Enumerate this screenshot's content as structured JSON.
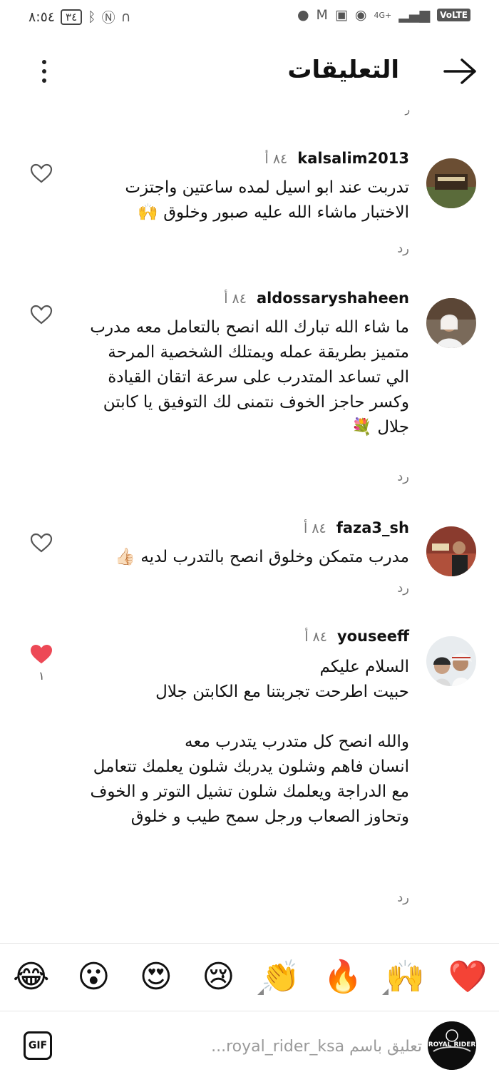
{
  "status_bar": {
    "time": "٨:٥٤",
    "battery": "٣٤",
    "network": "4G+",
    "volte": "VoLTE"
  },
  "header": {
    "title": "التعليقات"
  },
  "comments": [
    {
      "username": "kalsalim2013",
      "time": "٨٤ أ",
      "text": "تدربت عند ابو اسيل لمده ساعتين واجتزت الاختبار  ماشاء الله عليه صبور وخلوق 🙌",
      "reply_label": "رد",
      "liked": false,
      "like_count": ""
    },
    {
      "username": "aldossaryshaheen",
      "time": "٨٤ أ",
      "text": "ما شاء الله تبارك الله انصح بالتعامل معه مدرب متميز بطريقة عمله ويمتلك الشخصية المرحة الي تساعد المتدرب على سرعة اتقان القيادة وكسر حاجز الخوف نتمنى لك التوفيق يا كابتن جلال 💐",
      "reply_label": "رد",
      "liked": false,
      "like_count": ""
    },
    {
      "username": "faza3_sh",
      "time": "٨٤ أ",
      "text": "مدرب متمكن وخلوق انصح بالتدرب لديه 👍🏻",
      "reply_label": "رد",
      "liked": false,
      "like_count": ""
    },
    {
      "username": "youseeff",
      "time": "٨٤ أ",
      "text": "السلام عليكم\nحبيت اطرحت تجربتنا مع الكابتن جلال\n\nوالله انصح كل متدرب يتدرب معه\nانسان فاهم وشلون يدربك شلون يعلمك تتعامل مع الدراجة ويعلمك شلون تشيل التوتر و الخوف وتحاوز الصعاب ورجل سمح طيب و خلوق",
      "reply_label": "رد",
      "liked": true,
      "like_count": "١"
    }
  ],
  "emoji_bar": [
    "❤️",
    "🙌",
    "🔥",
    "👏",
    "😢",
    "😍",
    "😮",
    "😂"
  ],
  "input": {
    "placeholder": "تعليق باسم royal_rider_ksa...",
    "gif_label": "GIF",
    "avatar_text": "ROYAL RIDER"
  },
  "colors": {
    "liked_heart": "#ed4956",
    "meta_gray": "#777777"
  }
}
